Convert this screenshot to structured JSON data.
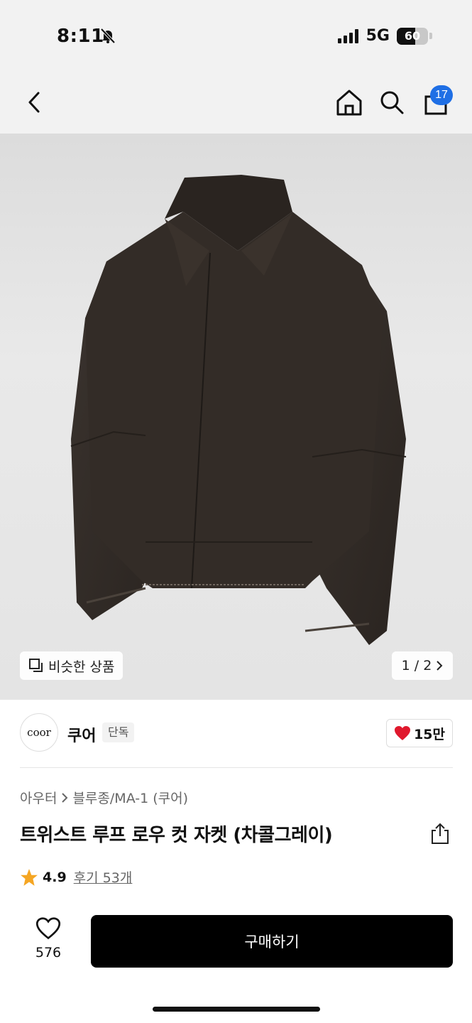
{
  "status_bar": {
    "time": "8:11",
    "network": "5G",
    "battery": "60",
    "battery_level": 0.6
  },
  "nav": {
    "cart_count": "17"
  },
  "gallery": {
    "similar_label": "비슷한 상품",
    "pager": "1 / 2"
  },
  "brand": {
    "logo_text": "coor",
    "name": "쿠어",
    "tag": "단독",
    "likes": "15만"
  },
  "product": {
    "breadcrumb": [
      "아우터",
      "블루종/MA-1 (쿠어)"
    ],
    "title": "트위스트 루프 로우 컷 자켓 (차콜그레이)",
    "rating": "4.9",
    "reviews": "후기 53개"
  },
  "bottom": {
    "wish_count": "576",
    "buy_label": "구매하기"
  },
  "colors": {
    "badge": "#1f6fe5",
    "heart": "#e0182d",
    "star": "#f5a623",
    "button": "#000000"
  }
}
